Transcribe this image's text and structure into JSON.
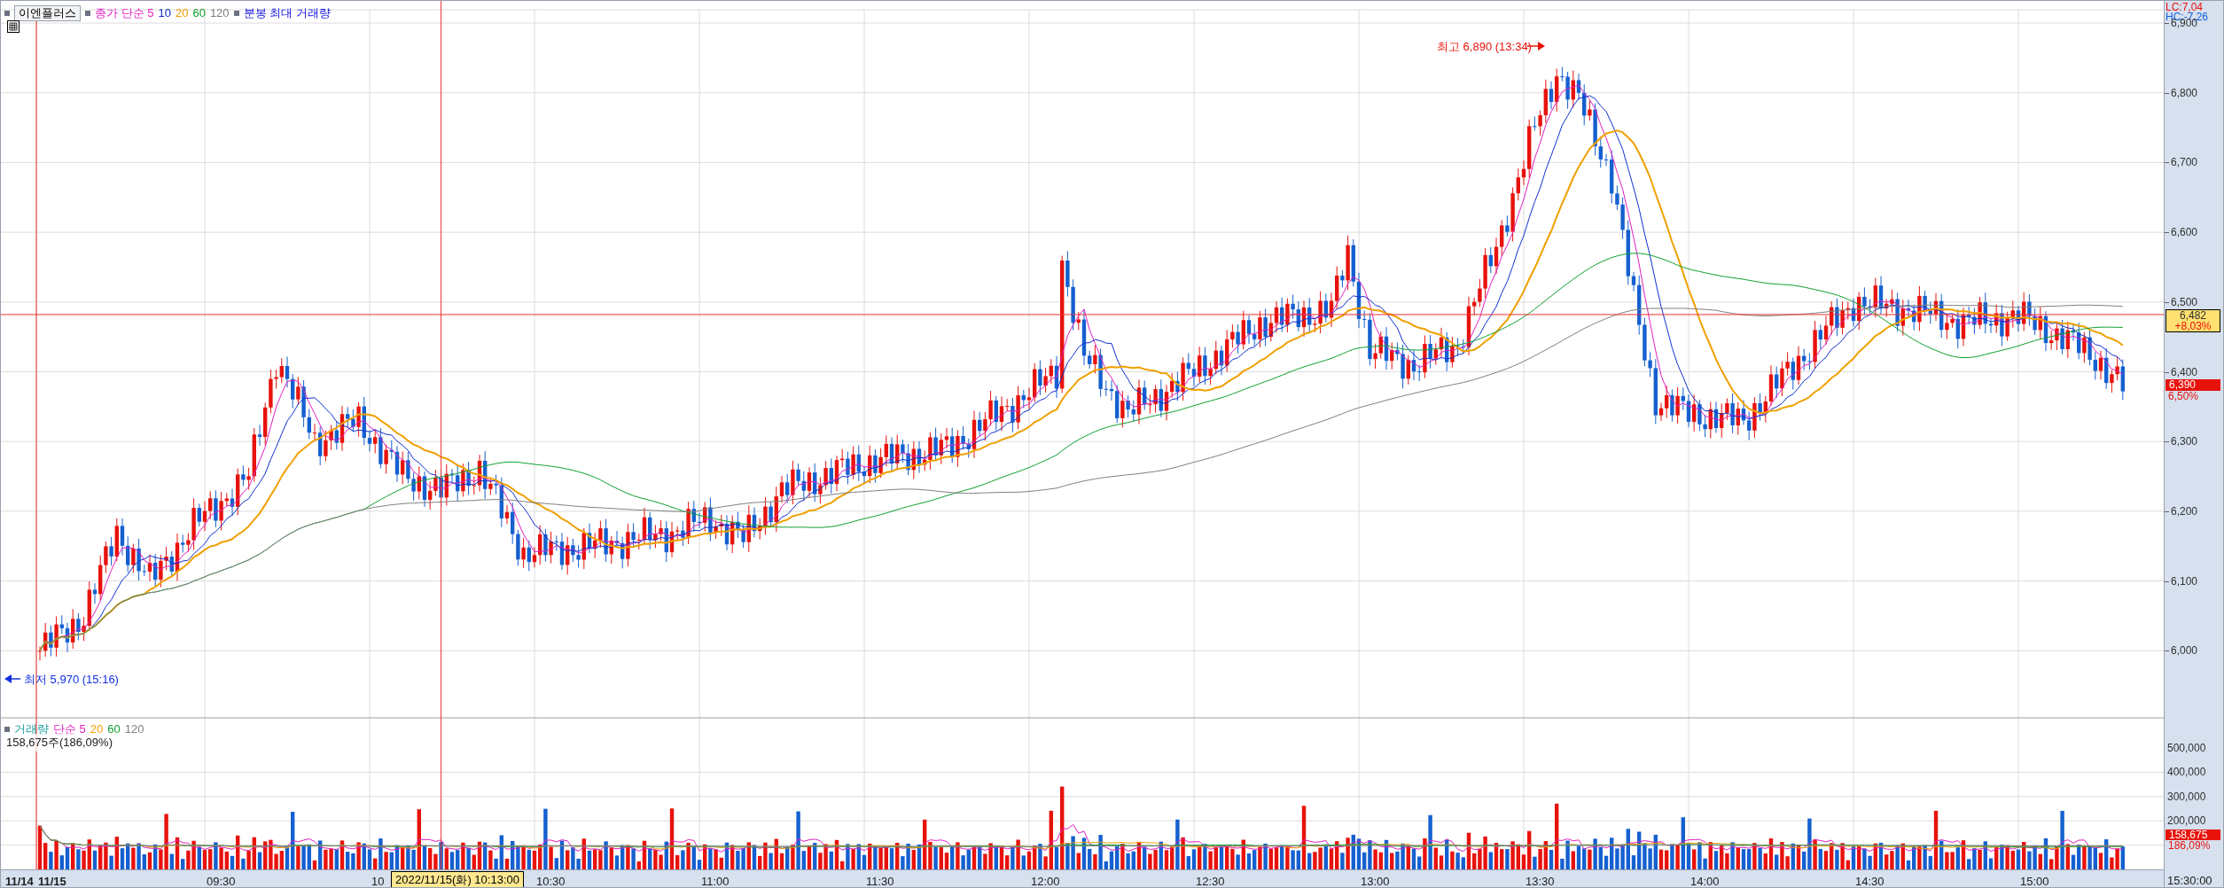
{
  "legend": {
    "symbol": "이엔플러스",
    "items": [
      {
        "text": "종가 단순 5",
        "color": "#e020c0"
      },
      {
        "text": "10",
        "color": "#1030d0"
      },
      {
        "text": "20",
        "color": "#f0a000"
      },
      {
        "text": "60",
        "color": "#10a030"
      },
      {
        "text": "120",
        "color": "#808080"
      }
    ],
    "extra": "분봉 최대 거래량"
  },
  "volume_legend": {
    "items": [
      {
        "text": "거래량",
        "color": "#20a0a0"
      },
      {
        "text": "단순 5",
        "color": "#e020c0"
      },
      {
        "text": "20",
        "color": "#f0a000"
      },
      {
        "text": "60",
        "color": "#10a030"
      },
      {
        "text": "120",
        "color": "#808080"
      }
    ],
    "reading": "158,675주(186,09%)"
  },
  "price_axis": {
    "lc": "LC:7,04",
    "hc": "HC:-7,26",
    "labels": [
      "6,900",
      "6,800",
      "6,700",
      "6,600",
      "6,500",
      "6,400",
      "6,300",
      "6,200",
      "6,100",
      "6,000"
    ]
  },
  "crosshair_tag": {
    "price": "6,482",
    "change": "+8,03%"
  },
  "current_tag": {
    "price": "6,390",
    "change": "6,50%"
  },
  "volume_axis": {
    "labels": [
      "500,000",
      "400,000",
      "300,000",
      "200,000"
    ],
    "current": "158,675",
    "change": "186,09%"
  },
  "annotations": {
    "high": "최고 6,890 (13:34)",
    "low": "최저 5,970 (15:16)"
  },
  "time_axis": {
    "labels": [
      "11/14",
      "11/15",
      "09:30",
      "10",
      "10:30",
      "11:00",
      "11:30",
      "12:00",
      "12:30",
      "13:00",
      "13:30",
      "14:00",
      "14:30",
      "15:00"
    ],
    "crosshair": "2022/11/15(화) 10:13:00",
    "end": "15:30:00"
  }
}
